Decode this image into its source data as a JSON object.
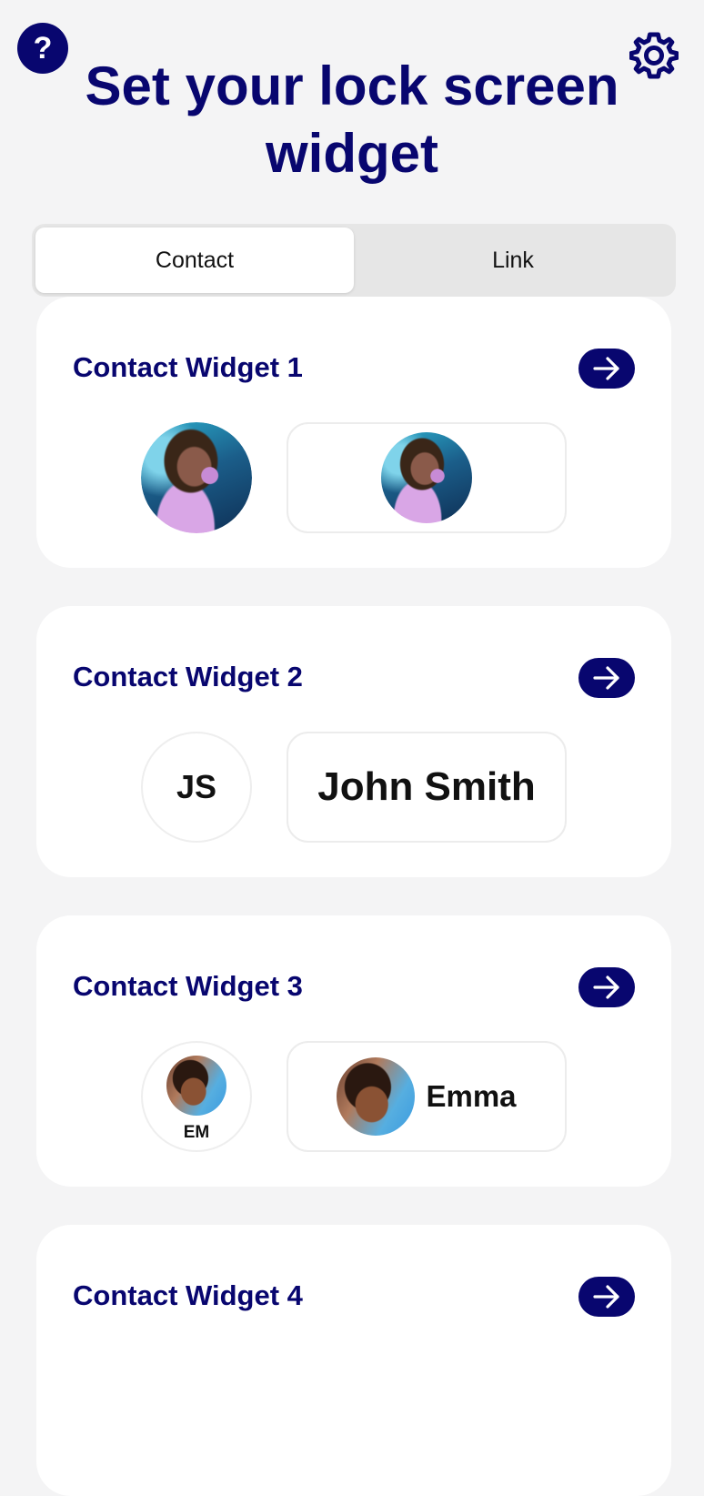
{
  "header": {
    "help_label": "?",
    "title": "Set your lock screen widget"
  },
  "tabs": [
    {
      "label": "Contact",
      "active": true
    },
    {
      "label": "Link",
      "active": false
    }
  ],
  "widgets": [
    {
      "title": "Contact Widget 1",
      "type": "photo"
    },
    {
      "title": "Contact Widget 2",
      "initials": "JS",
      "name": "John Smith"
    },
    {
      "title": "Contact Widget 3",
      "initials": "EM",
      "name": "Emma"
    },
    {
      "title": "Contact Widget 4"
    }
  ],
  "colors": {
    "accent": "#08066f",
    "background": "#f4f4f5",
    "card": "#ffffff"
  },
  "icons": {
    "help": "question-mark-icon",
    "settings": "gear-icon",
    "open": "arrow-right-icon"
  }
}
